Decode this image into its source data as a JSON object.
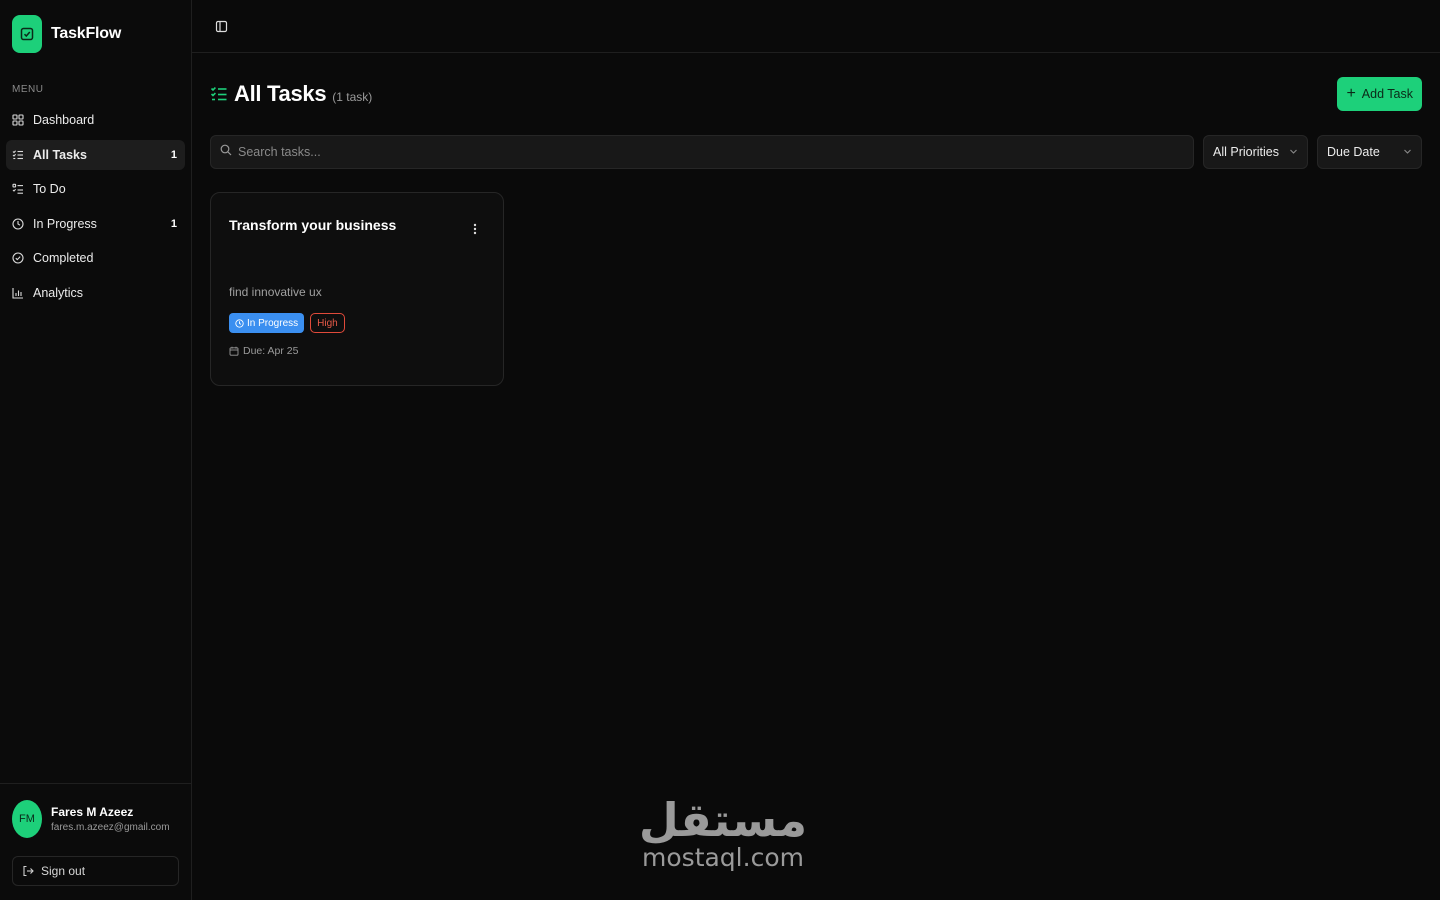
{
  "app": {
    "name": "TaskFlow"
  },
  "sidebar": {
    "menu_label": "MENU",
    "items": [
      {
        "label": "Dashboard",
        "icon": "dashboard-icon",
        "count": ""
      },
      {
        "label": "All Tasks",
        "icon": "list-check-icon",
        "count": "1",
        "active": true
      },
      {
        "label": "To Do",
        "icon": "list-todo-icon",
        "count": ""
      },
      {
        "label": "In Progress",
        "icon": "clock-icon",
        "count": "1"
      },
      {
        "label": "Completed",
        "icon": "check-circle-icon",
        "count": ""
      },
      {
        "label": "Analytics",
        "icon": "bar-chart-icon",
        "count": ""
      }
    ],
    "user": {
      "initials": "FM",
      "name": "Fares M Azeez",
      "email": "fares.m.azeez@gmail.com"
    },
    "signout_label": "Sign out"
  },
  "header": {
    "title": "All Tasks",
    "count_text": "(1 task)",
    "add_button_label": "Add Task"
  },
  "filters": {
    "search_placeholder": "Search tasks...",
    "priority_value": "All Priorities",
    "sort_value": "Due Date"
  },
  "tasks": [
    {
      "title": "Transform your business",
      "description": "find innovative ux",
      "status": "In Progress",
      "priority": "High",
      "due": "Due: Apr 25"
    }
  ],
  "watermark": {
    "arabic": "مستقل",
    "latin": "mostaql.com"
  },
  "colors": {
    "accent": "#1dd07a",
    "background": "#0a0a0a",
    "status_in_progress": "#3b8ff0",
    "priority_high": "#e04a3a"
  }
}
